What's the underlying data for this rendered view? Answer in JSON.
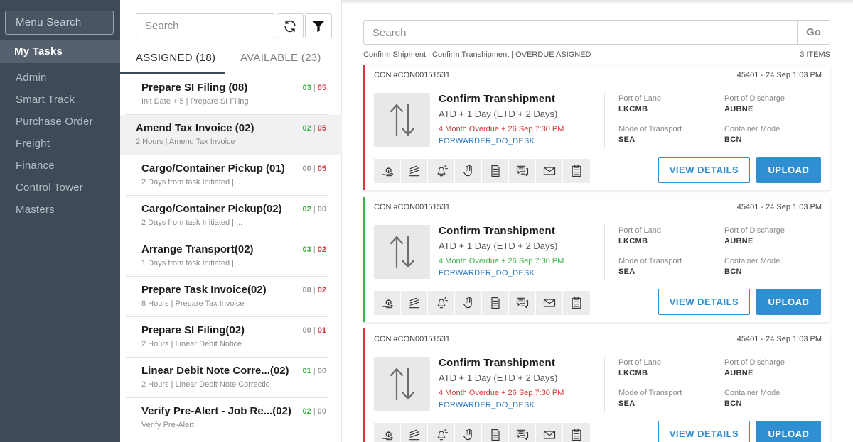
{
  "sidebar": {
    "search_placeholder": "Menu Search",
    "items": [
      {
        "label": "My Tasks"
      },
      {
        "label": "Admin"
      },
      {
        "label": "Smart Track"
      },
      {
        "label": "Purchase Order"
      },
      {
        "label": "Freight"
      },
      {
        "label": "Finance"
      },
      {
        "label": "Control Tower"
      },
      {
        "label": "Masters"
      }
    ]
  },
  "tasks": {
    "search_placeholder": "Search",
    "tabs": [
      {
        "label": "ASSIGNED (18)"
      },
      {
        "label": "AVAILABLE (23)"
      }
    ],
    "items": [
      {
        "title": "Prepare SI Filing (08)",
        "sub": "Init Date + 5 | Prepare SI Filing",
        "count_a": "03",
        "sep": "|",
        "count_b": "05"
      },
      {
        "title": "Amend Tax Invoice (02)",
        "sub": "2 Hours | Amend Tax Invoice",
        "count_a": "02",
        "sep": "|",
        "count_b": "05"
      },
      {
        "title": "Cargo/Container Pickup (01)",
        "sub": "2 Days from task Initiated | ...",
        "count_a": "00",
        "sep": "|",
        "count_b": "05"
      },
      {
        "title": "Cargo/Container Pickup(02)",
        "sub": "2 Days from task Initiated | ...",
        "count_a": "02",
        "sep": "|",
        "count_b": "00"
      },
      {
        "title": "Arrange Transport(02)",
        "sub": "1 Days from task Initiated | ...",
        "count_a": "03",
        "sep": "|",
        "count_b": "02"
      },
      {
        "title": "Prepare Task Invoice(02)",
        "sub": "8 Hours | Prepare Tax Invoice",
        "count_a": "00",
        "sep": "|",
        "count_b": "02"
      },
      {
        "title": "Prepare SI Filing(02)",
        "sub": "2 Hours | Linear Debit Notice",
        "count_a": "00",
        "sep": "|",
        "count_b": "01"
      },
      {
        "title": "Linear Debit Note Corre...(02)",
        "sub": "2 Hours | Linear Debit Note Correctio",
        "count_a": "01",
        "sep": "|",
        "count_b": "00"
      },
      {
        "title": "Verify Pre-Alert - Job Re...(02)",
        "sub": "Verify Pre-Alert",
        "count_a": "02",
        "sep": "|",
        "count_b": "00"
      }
    ]
  },
  "main": {
    "search_placeholder": "Search",
    "go_label": "Go",
    "filter_crumb": "Confirm Shipment | Confirm Transhipment | OVERDUE ASIGNED",
    "items_count": "3 ITEMS",
    "cards": [
      {
        "con": "CON #CON00151531",
        "date": "45401 - 24 Sep 1:03 PM",
        "title": "Confirm Transhipment",
        "atd": "ATD + 1 Day (ETD + 2 Days)",
        "overdue": "4 Month Overdue + 26 Sep 7:30 PM",
        "status": "red",
        "desk": "FORWARDER_DO_DESK",
        "port_land_label": "Port of Land",
        "port_land": "LKCMB",
        "port_discharge_label": "Port of Discharge",
        "port_discharge": "AUBNE",
        "transport_label": "Mode of Transport",
        "transport": "SEA",
        "container_label": "Container Mode",
        "container": "BCN",
        "view_label": "VIEW DETAILS",
        "upload_label": "UPLOAD"
      },
      {
        "con": "CON #CON00151531",
        "date": "45401 - 24 Sep 1:03 PM",
        "title": "Confirm Transhipment",
        "atd": "ATD + 1 Day (ETD + 2 Days)",
        "overdue": "4 Month Overdue + 26 Sep 7:30 PM",
        "status": "green",
        "desk": "FORWARDER_DO_DESK",
        "port_land_label": "Port of Land",
        "port_land": "LKCMB",
        "port_discharge_label": "Port of Discharge",
        "port_discharge": "AUBNE",
        "transport_label": "Mode of Transport",
        "transport": "SEA",
        "container_label": "Container Mode",
        "container": "BCN",
        "view_label": "VIEW DETAILS",
        "upload_label": "UPLOAD"
      },
      {
        "con": "CON #CON00151531",
        "date": "45401 - 24 Sep 1:03 PM",
        "title": "Confirm Transhipment",
        "atd": "ATD + 1 Day (ETD + 2 Days)",
        "overdue": "4 Month Overdue + 26 Sep 7:30 PM",
        "status": "red",
        "desk": "FORWARDER_DO_DESK",
        "port_land_label": "Port of Land",
        "port_land": "LKCMB",
        "port_discharge_label": "Port of Discharge",
        "port_discharge": "AUBNE",
        "transport_label": "Mode of Transport",
        "transport": "SEA",
        "container_label": "Container Mode",
        "container": "BCN",
        "view_label": "VIEW DETAILS",
        "upload_label": "UPLOAD"
      }
    ]
  },
  "colors": {
    "sidebar_bg": "#3f4a58",
    "accent_blue": "#2f8fd0",
    "overdue_red": "#d9363e",
    "ok_green": "#3cb44b"
  }
}
